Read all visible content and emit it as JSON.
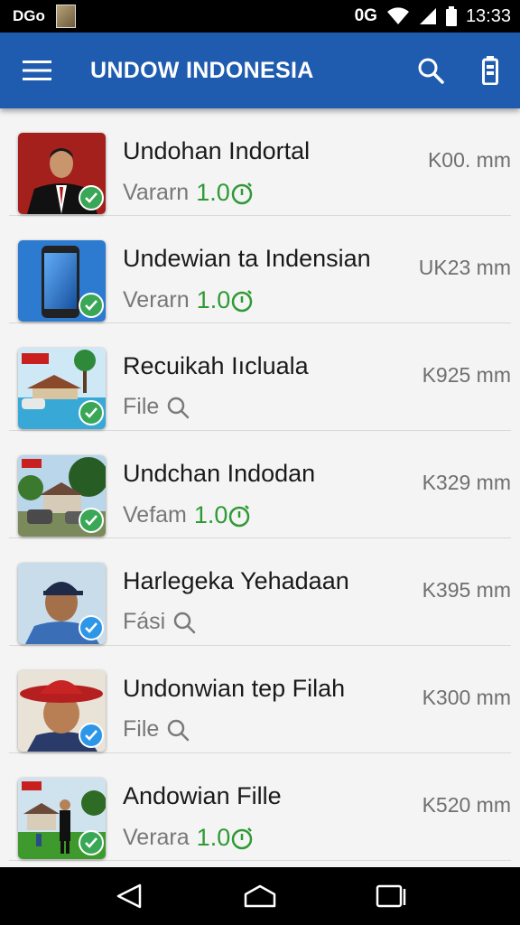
{
  "status_bar": {
    "carrier": "DGo",
    "network": "0G",
    "time": "13:33"
  },
  "app_bar": {
    "title": "UNDOW INDONESIA",
    "icons": [
      "menu-icon",
      "search-icon",
      "battery-icon"
    ]
  },
  "items": [
    {
      "title": "Undohan Indortal",
      "subtitle": "Vararn",
      "version": "1.0",
      "meta_icon": "version-clock-icon",
      "size": "K00. mm",
      "badge": "green",
      "thumbnail": "man-in-suit"
    },
    {
      "title": "Undewian ta Indensian",
      "subtitle": "Verarn",
      "version": "1.0",
      "meta_icon": "version-clock-icon",
      "size": "UK23 mm",
      "badge": "green",
      "thumbnail": "smartphone"
    },
    {
      "title": "Recuikah Iıcluala",
      "subtitle": "File",
      "version": "",
      "meta_icon": "search-icon",
      "size": "K925 mm",
      "badge": "green",
      "thumbnail": "resort-pool"
    },
    {
      "title": "Undchan Indodan",
      "subtitle": "Vefam",
      "version": "1.0",
      "meta_icon": "version-clock-icon",
      "size": "K329 mm",
      "badge": "green",
      "thumbnail": "house-trees"
    },
    {
      "title": "Harlegeka Yehadaan",
      "subtitle": "Fási",
      "version": "",
      "meta_icon": "search-icon",
      "size": "K395 mm",
      "badge": "blue",
      "thumbnail": "boy-cap"
    },
    {
      "title": "Undonwian tep Filah",
      "subtitle": "File",
      "version": "",
      "meta_icon": "search-icon",
      "size": "K300 mm",
      "badge": "blue",
      "thumbnail": "boy-red-hat"
    },
    {
      "title": "Andowian Fille",
      "subtitle": "Verara",
      "version": "1.0",
      "meta_icon": "version-clock-icon",
      "size": "K520 mm",
      "badge": "green",
      "thumbnail": "man-on-lawn"
    }
  ],
  "nav_bar": {
    "icons": [
      "back-icon",
      "home-icon",
      "recents-icon"
    ]
  },
  "colors": {
    "app_bar": "#1f5cb0",
    "version_text": "#2f9a35",
    "badge_green": "#3aa757",
    "badge_blue": "#2e96e8"
  }
}
